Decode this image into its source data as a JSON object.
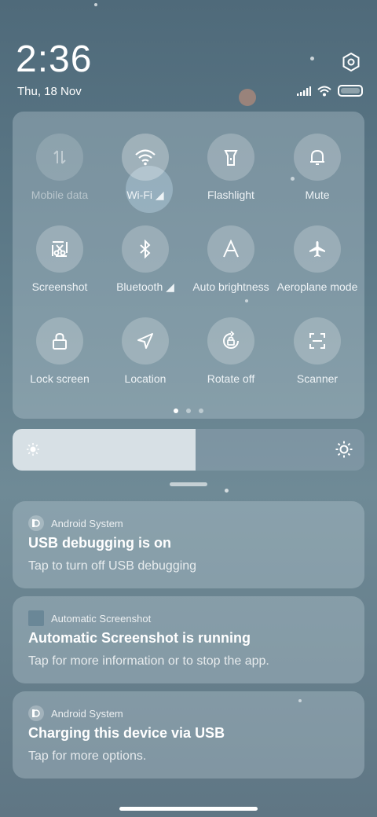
{
  "status": {
    "time": "2:36",
    "date": "Thu, 18 Nov"
  },
  "quick_settings": {
    "tiles": [
      {
        "label": "Mobile data",
        "icon": "mobile-data-icon",
        "state": "disabled"
      },
      {
        "label": "Wi-Fi",
        "icon": "wifi-icon",
        "state": "on"
      },
      {
        "label": "Flashlight",
        "icon": "flashlight-icon",
        "state": "off"
      },
      {
        "label": "Mute",
        "icon": "bell-icon",
        "state": "off"
      },
      {
        "label": "Screenshot",
        "icon": "screenshot-icon",
        "state": "off"
      },
      {
        "label": "Bluetooth",
        "icon": "bluetooth-icon",
        "state": "off"
      },
      {
        "label": "Auto brightness",
        "icon": "auto-brightness-icon",
        "state": "off"
      },
      {
        "label": "Aeroplane mode",
        "icon": "airplane-icon",
        "state": "off"
      },
      {
        "label": "Lock screen",
        "icon": "lock-icon",
        "state": "off"
      },
      {
        "label": "Location",
        "icon": "location-icon",
        "state": "off"
      },
      {
        "label": "Rotate off",
        "icon": "rotate-lock-icon",
        "state": "off"
      },
      {
        "label": "Scanner",
        "icon": "scanner-icon",
        "state": "off"
      }
    ],
    "page_count": 3,
    "current_page": 1
  },
  "brightness": {
    "level_percent": 52
  },
  "notifications": [
    {
      "app": "Android System",
      "title": "USB debugging is on",
      "body": "Tap to turn off USB debugging"
    },
    {
      "app": "Automatic Screenshot",
      "title": "Automatic Screenshot is running",
      "body": "Tap for more information or to stop the app."
    },
    {
      "app": "Android System",
      "title": "Charging this device via USB",
      "body": "Tap for more options."
    }
  ],
  "colors": {
    "background": "#5f7c8a",
    "panel": "#bccdd7",
    "brightness_fill": "#dce4e9"
  }
}
